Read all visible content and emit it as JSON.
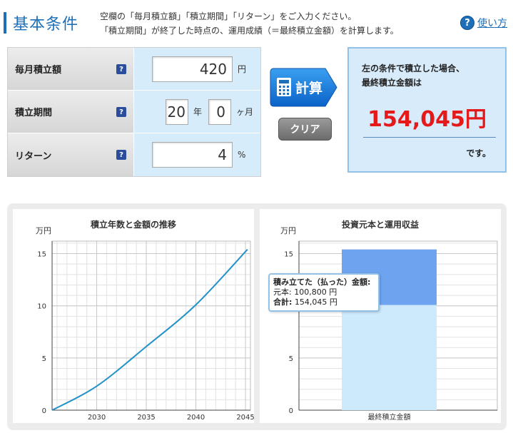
{
  "header": {
    "title": "基本条件",
    "desc_line1": "空欄の「毎月積立額」「積立期間」「リターン」をご入力ください。",
    "desc_line2": "「積立期間」が終了した時点の、運用成績（＝最終積立金額）を計算します。",
    "help_label": "使い方"
  },
  "form": {
    "monthly": {
      "label": "毎月積立額",
      "value": "420",
      "unit": "円"
    },
    "period": {
      "label": "積立期間",
      "years": "20",
      "years_unit": "年",
      "months": "0",
      "months_unit": "ヶ月"
    },
    "return": {
      "label": "リターン",
      "value": "4",
      "unit": "%"
    },
    "help_glyph": "?"
  },
  "buttons": {
    "calc": "計算",
    "clear": "クリア"
  },
  "result": {
    "line1": "左の条件で積立した場合、",
    "line2": "最終積立金額は",
    "amount": "154,045円",
    "suffix": "です。"
  },
  "colors": {
    "accent": "#1d6fb8",
    "amount": "#e6191a",
    "line": "#2292c8",
    "bar_principal": "#cdeafc",
    "bar_gain": "#6ea4ef"
  },
  "tooltip": {
    "title": "積み立てた（払った）金額:",
    "principal_label": "元本:",
    "principal_value": "100,800 円",
    "total_label": "合計:",
    "total_value": "154,045 円"
  },
  "chart_data": [
    {
      "type": "line",
      "title": "積立年数と金額の推移",
      "ylabel": "万円",
      "x": [
        2025.5,
        2030,
        2035,
        2040,
        2045.2
      ],
      "series": [
        {
          "values": [
            0,
            2.3,
            6.1,
            10.1,
            15.4
          ]
        }
      ],
      "xticks": [
        "2030",
        "2035",
        "2040",
        "2045"
      ],
      "yticks": [
        "0",
        "5",
        "10",
        "15"
      ],
      "xlim": [
        2025.5,
        2045.5
      ],
      "ylim": [
        0,
        16.2
      ],
      "grid": true
    },
    {
      "type": "bar",
      "title": "投資元本と運用収益",
      "ylabel": "万円",
      "categories": [
        "最終積立金額"
      ],
      "series": [
        {
          "values": [
            10.08
          ]
        },
        {
          "values": [
            5.3245
          ]
        }
      ],
      "stacked": true,
      "yticks": [
        "0",
        "5",
        "10",
        "15"
      ],
      "ylim": [
        0,
        16.2
      ],
      "grid": true
    }
  ]
}
